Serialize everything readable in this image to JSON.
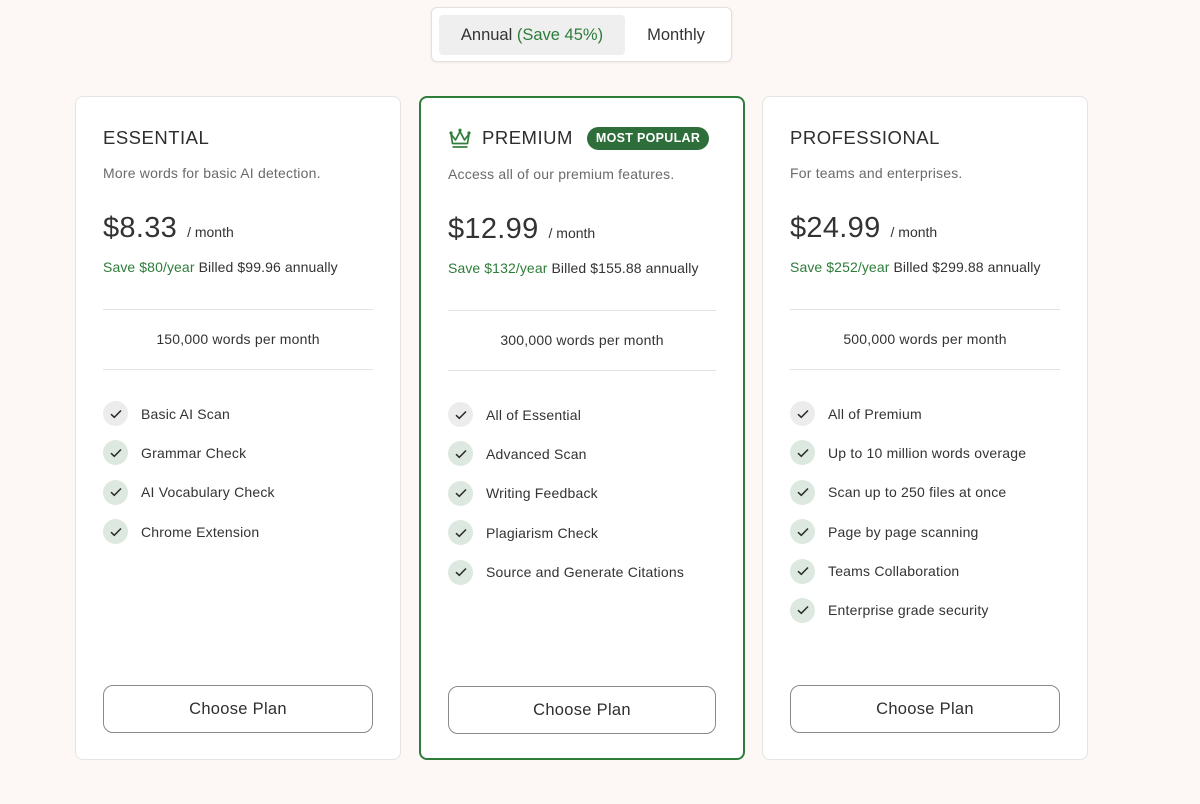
{
  "billing_toggle": {
    "annual_label": "Annual",
    "annual_save": "(Save 45%)",
    "monthly_label": "Monthly"
  },
  "plans": [
    {
      "name": "ESSENTIAL",
      "description": "More words for basic AI detection.",
      "price": "$8.33",
      "per": "/ month",
      "save": "Save $80/year",
      "billed": "Billed $99.96 annually",
      "words": "150,000 words per month",
      "features": [
        "Basic AI Scan",
        "Grammar Check",
        "AI Vocabulary Check",
        "Chrome Extension"
      ],
      "button": "Choose Plan"
    },
    {
      "name": "PREMIUM",
      "badge": "MOST POPULAR",
      "icon": "crown-icon",
      "description": "Access all of our premium features.",
      "price": "$12.99",
      "per": "/ month",
      "save": "Save $132/year",
      "billed": "Billed $155.88 annually",
      "words": "300,000 words per month",
      "features": [
        "All of Essential",
        "Advanced Scan",
        "Writing Feedback",
        "Plagiarism Check",
        "Source and Generate Citations"
      ],
      "button": "Choose Plan"
    },
    {
      "name": "PROFESSIONAL",
      "description": "For teams and enterprises.",
      "price": "$24.99",
      "per": "/ month",
      "save": "Save $252/year",
      "billed": "Billed $299.88 annually",
      "words": "500,000 words per month",
      "features": [
        "All of Premium",
        "Up to 10 million words overage",
        "Scan up to 250 files at once",
        "Page by page scanning",
        "Teams Collaboration",
        "Enterprise grade security"
      ],
      "button": "Choose Plan"
    }
  ],
  "colors": {
    "accent_green": "#2e7d3a",
    "badge_green": "#2e6e3a",
    "background": "#fdf8f5"
  }
}
